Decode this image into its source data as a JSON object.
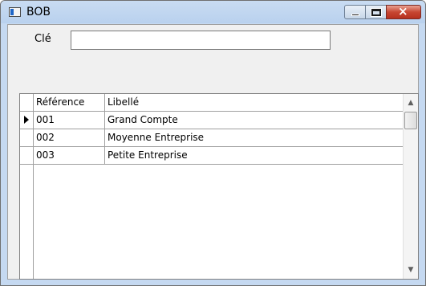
{
  "window": {
    "title": "BOB"
  },
  "form": {
    "key_label": "Clé",
    "key_value": ""
  },
  "grid": {
    "columns": [
      "Référence",
      "Libellé"
    ],
    "rows": [
      {
        "reference": "001",
        "libelle": "Grand Compte",
        "current": true
      },
      {
        "reference": "002",
        "libelle": "Moyenne Entreprise",
        "current": false
      },
      {
        "reference": "003",
        "libelle": "Petite Entreprise",
        "current": false
      }
    ]
  },
  "icons": {
    "app": "app-window-icon",
    "minimize": "minimize-icon",
    "maximize": "maximize-icon",
    "close": "close-icon",
    "row_pointer": "row-pointer-icon",
    "scroll_up": "scroll-up-arrow-icon",
    "scroll_down": "scroll-down-arrow-icon"
  },
  "colors": {
    "titlebar": "#c9dcf2",
    "close_button": "#c74632",
    "client_background": "#f0f0f0"
  }
}
